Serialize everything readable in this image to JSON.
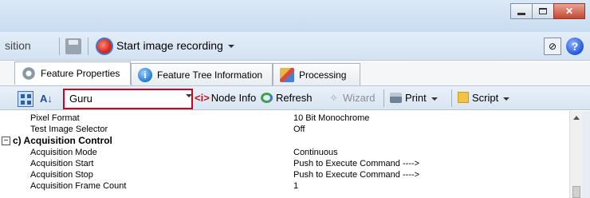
{
  "toolbar": {
    "partial_label": "sition",
    "record_label": "Start image recording"
  },
  "tabs": [
    {
      "label": "Feature Properties"
    },
    {
      "label": "Feature Tree Information"
    },
    {
      "label": "Processing"
    }
  ],
  "properties_toolbar": {
    "visibility_value": "Guru",
    "node_info_tag": "<i>",
    "node_info_label": "Node Info",
    "refresh_label": "Refresh",
    "wizard_label": "Wizard",
    "print_label": "Print",
    "script_label": "Script"
  },
  "grid": {
    "rows": [
      {
        "name": "Pixel Format",
        "value": "10 Bit Monochrome"
      },
      {
        "name": "Test Image Selector",
        "value": "Off"
      },
      {
        "category": true,
        "name": "c) Acquisition Control",
        "toggle": "−"
      },
      {
        "name": "Acquisition Mode",
        "value": "Continuous"
      },
      {
        "name": "Acquisition Start",
        "value": "Push to Execute Command ---->"
      },
      {
        "name": "Acquisition Stop",
        "value": "Push to Execute Command ---->"
      },
      {
        "name": "Acquisition Frame Count",
        "value": "1"
      }
    ]
  },
  "colors": {
    "highlight_border": "#d0021b"
  }
}
